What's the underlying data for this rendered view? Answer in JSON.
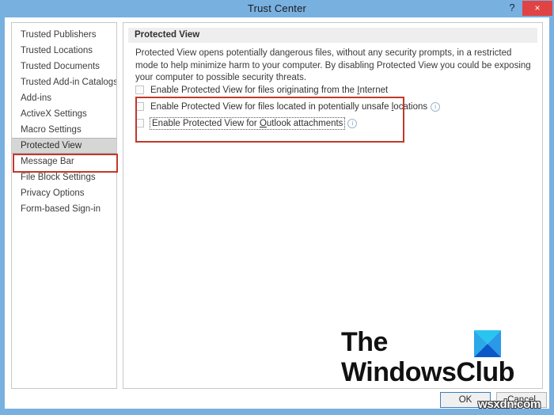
{
  "window": {
    "title": "Trust Center",
    "help_label": "?",
    "close_label": "×",
    "titlebar_color": "#78b0e0",
    "close_color": "#e04343"
  },
  "sidebar": {
    "items": [
      {
        "label": "Trusted Publishers",
        "selected": false
      },
      {
        "label": "Trusted Locations",
        "selected": false
      },
      {
        "label": "Trusted Documents",
        "selected": false
      },
      {
        "label": "Trusted Add-in Catalogs",
        "selected": false
      },
      {
        "label": "Add-ins",
        "selected": false
      },
      {
        "label": "ActiveX Settings",
        "selected": false
      },
      {
        "label": "Macro Settings",
        "selected": false
      },
      {
        "label": "Protected View",
        "selected": true
      },
      {
        "label": "Message Bar",
        "selected": false
      },
      {
        "label": "File Block Settings",
        "selected": false
      },
      {
        "label": "Privacy Options",
        "selected": false
      },
      {
        "label": "Form-based Sign-in",
        "selected": false
      }
    ]
  },
  "content": {
    "header": "Protected View",
    "description": "Protected View opens potentially dangerous files, without any security prompts, in a restricted mode to help minimize harm to your computer. By disabling Protected View you could be exposing your computer to possible security threats.",
    "options": [
      {
        "label_before": "Enable Protected View for files originating from the ",
        "accel": "I",
        "label_after": "nternet",
        "checked": false,
        "info": false,
        "focused": false
      },
      {
        "label_before": "Enable Protected View for files located in potentially unsafe ",
        "accel": "l",
        "label_after": "ocations",
        "checked": false,
        "info": true,
        "focused": false
      },
      {
        "label_before": "Enable Protected View for ",
        "accel": "O",
        "label_after": "utlook attachments",
        "checked": false,
        "info": true,
        "focused": true
      }
    ],
    "info_icon_glyph": "i"
  },
  "annotations": {
    "color": "#c0392b",
    "options_box": "red-highlight-options",
    "nav_box": "red-highlight-protected-view"
  },
  "watermark": {
    "line1": "The",
    "line2": "WindowsClub",
    "logo_colors": {
      "top": "#29c4f0",
      "left": "#2aa8e8",
      "right": "#2a9ae8",
      "bottom": "#0b57c8"
    },
    "url": "wsxdn.com"
  },
  "footer": {
    "ok_label": "OK",
    "cancel_label": "Cancel"
  }
}
